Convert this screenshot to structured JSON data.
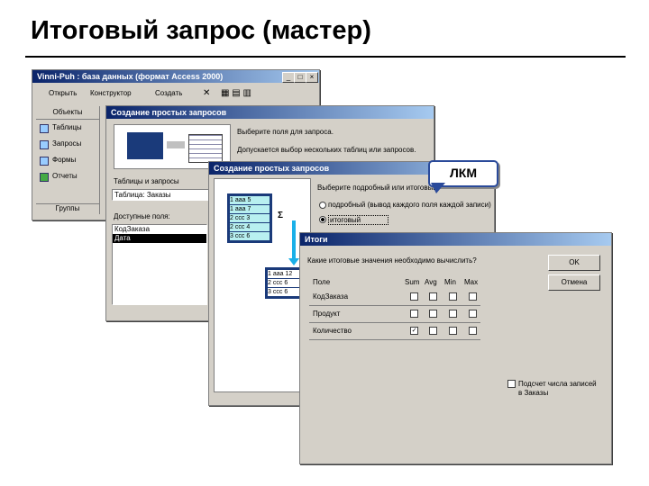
{
  "slide": {
    "title": "Итоговый запрос (мастер)"
  },
  "main_window": {
    "title": "Vinni-Puh : база данных (формат Access 2000)",
    "toolbar": {
      "open": "Открыть",
      "design": "Конструктор",
      "create": "Создать"
    },
    "objects_header": "Объекты",
    "objects": [
      "Таблицы",
      "Запросы",
      "Формы",
      "Отчеты"
    ],
    "groups": "Группы"
  },
  "wizard1": {
    "title": "Создание простых запросов",
    "instruction1": "Выберите поля для запроса.",
    "instruction2": "Допускается выбор нескольких таблиц или запросов.",
    "tables_label": "Таблицы и запросы",
    "tables_value": "Таблица: Заказы",
    "available_label": "Доступные поля:",
    "fields": [
      "КодЗаказа",
      "Дата"
    ]
  },
  "wizard2": {
    "title": "Создание простых запросов",
    "question": "Выберите подробный или итоговый",
    "option_detail": "подробный (вывод каждого поля каждой записи)",
    "option_summary": "итоговый",
    "sample_rows": [
      {
        "n": "1",
        "t": "aaa",
        "v": "5"
      },
      {
        "n": "1",
        "t": "aaa",
        "v": "7"
      },
      {
        "n": "2",
        "t": "ccc",
        "v": "3"
      },
      {
        "n": "2",
        "t": "ccc",
        "v": "4"
      },
      {
        "n": "3",
        "t": "ccc",
        "v": "6"
      }
    ],
    "sum_symbol": "Σ",
    "result_rows": [
      {
        "n": "1",
        "t": "aaa",
        "v": "12"
      },
      {
        "n": "2",
        "t": "ccc",
        "v": "6"
      },
      {
        "n": "3",
        "t": "ccc",
        "v": "6"
      }
    ]
  },
  "totals_dialog": {
    "title": "Итоги",
    "question": "Какие итоговые значения необходимо вычислить?",
    "col_field": "Поле",
    "cols": [
      "Sum",
      "Avg",
      "Min",
      "Max"
    ],
    "rows": [
      {
        "name": "КодЗаказа",
        "checks": [
          false,
          false,
          false,
          false
        ]
      },
      {
        "name": "Продукт",
        "checks": [
          false,
          false,
          false,
          false
        ]
      },
      {
        "name": "Количество",
        "checks": [
          true,
          false,
          false,
          false
        ]
      }
    ],
    "ok": "OK",
    "cancel": "Отмена",
    "count_label": "Подсчет числа записей в Заказы"
  },
  "callout": {
    "text": "ЛКМ"
  },
  "colors": {
    "titlebar": "#0a246a",
    "dialog": "#d4d0c8",
    "callout_border": "#2a4a9a",
    "arrow": "#1ab0e8"
  }
}
